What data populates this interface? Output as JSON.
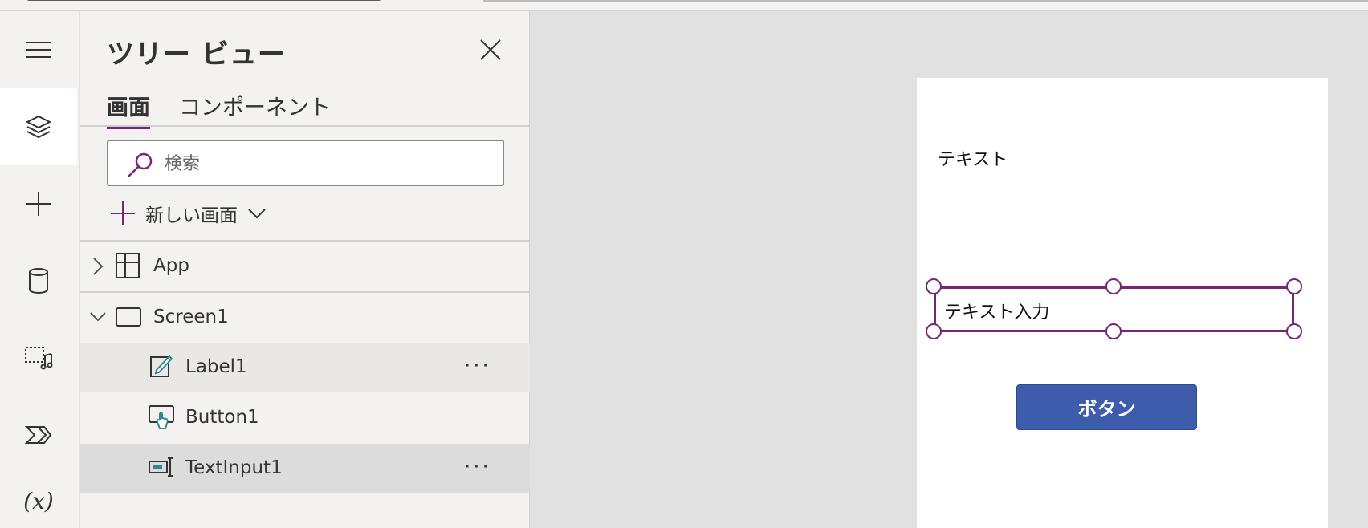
{
  "rail": {
    "items": [
      {
        "icon": "hamburger-menu-icon"
      },
      {
        "icon": "layers-icon",
        "active": true
      },
      {
        "icon": "plus-icon"
      },
      {
        "icon": "database-icon"
      },
      {
        "icon": "media-icon"
      },
      {
        "icon": "power-automate-icon"
      },
      {
        "icon": "variables-icon",
        "glyph": "(x)"
      }
    ]
  },
  "panel": {
    "title": "ツリー ビュー",
    "tabs": [
      {
        "label": "画面",
        "selected": true
      },
      {
        "label": "コンポーネント",
        "selected": false
      }
    ],
    "search": {
      "placeholder": "検索",
      "value": ""
    },
    "new_screen_label": "新しい画面",
    "tree": [
      {
        "label": "App",
        "expanded": false,
        "icon": "app-grid-icon"
      },
      {
        "label": "Screen1",
        "expanded": true,
        "icon": "screen-icon"
      },
      {
        "label": "Label1",
        "icon": "label-edit-icon",
        "state": "hover",
        "more": "···"
      },
      {
        "label": "Button1",
        "icon": "button-touch-icon"
      },
      {
        "label": "TextInput1",
        "icon": "text-input-icon",
        "state": "selected",
        "more": "···"
      }
    ]
  },
  "canvas": {
    "label_text": "テキスト",
    "textinput_text": "テキスト入力",
    "button_text": "ボタン"
  },
  "colors": {
    "accent": "#742774",
    "button": "#3d5cab",
    "panel_bg": "#f3f2f1",
    "canvas_bg": "#e1e1e1"
  }
}
